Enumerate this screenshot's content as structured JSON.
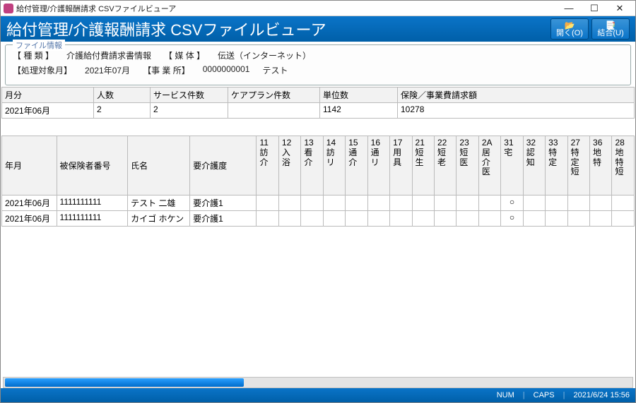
{
  "window": {
    "title": "給付管理/介護報酬請求 CSVファイルビューア"
  },
  "header": {
    "title": "給付管理/介護報酬請求 CSVファイルビューア",
    "open_label": "開く(O)",
    "merge_label": "結合(U)"
  },
  "fileinfo": {
    "legend": "ファイル情報",
    "type_label": "【 種 類 】",
    "type_value": "介護給付費請求書情報",
    "media_label": "【 媒 体 】",
    "media_value": "伝送（インターネット）",
    "month_label": "【処理対象月】",
    "month_value": "2021年07月",
    "office_label": "【事 業 所】",
    "office_code": "0000000001",
    "office_name": "テスト"
  },
  "summary": {
    "headers": {
      "month": "月分",
      "people": "人数",
      "services": "サービス件数",
      "careplans": "ケアプラン件数",
      "units": "単位数",
      "bill": "保険／事業費請求額"
    },
    "row": {
      "month": "2021年06月",
      "people": "2",
      "services": "2",
      "careplans": "",
      "units": "1142",
      "bill": "10278"
    }
  },
  "detail": {
    "headers": {
      "ym": "年月",
      "insured_no": "被保険者番号",
      "name": "氏名",
      "carelevel": "要介護度",
      "cols": [
        {
          "code": "11",
          "label": "訪介"
        },
        {
          "code": "12",
          "label": "入浴"
        },
        {
          "code": "13",
          "label": "看介"
        },
        {
          "code": "14",
          "label": "訪リ"
        },
        {
          "code": "15",
          "label": "通介"
        },
        {
          "code": "16",
          "label": "通リ"
        },
        {
          "code": "17",
          "label": "用具"
        },
        {
          "code": "21",
          "label": "短生"
        },
        {
          "code": "22",
          "label": "短老"
        },
        {
          "code": "23",
          "label": "短医"
        },
        {
          "code": "2A",
          "label": "居介医"
        },
        {
          "code": "31",
          "label": "宅"
        },
        {
          "code": "32",
          "label": "認知"
        },
        {
          "code": "33",
          "label": "特定"
        },
        {
          "code": "27",
          "label": "特定短"
        },
        {
          "code": "36",
          "label": "地特"
        },
        {
          "code": "28",
          "label": "地特短"
        }
      ]
    },
    "rows": [
      {
        "ym": "2021年06月",
        "insured_no": "1111111111",
        "name": "テスト 二雄",
        "carelevel": "要介護1",
        "marks": {
          "31": "○"
        }
      },
      {
        "ym": "2021年06月",
        "insured_no": "1111111111",
        "name": "カイゴ ホケン",
        "carelevel": "要介護1",
        "marks": {
          "31": "○"
        }
      }
    ]
  },
  "status": {
    "num": "NUM",
    "caps": "CAPS",
    "datetime": "2021/6/24 15:56"
  }
}
